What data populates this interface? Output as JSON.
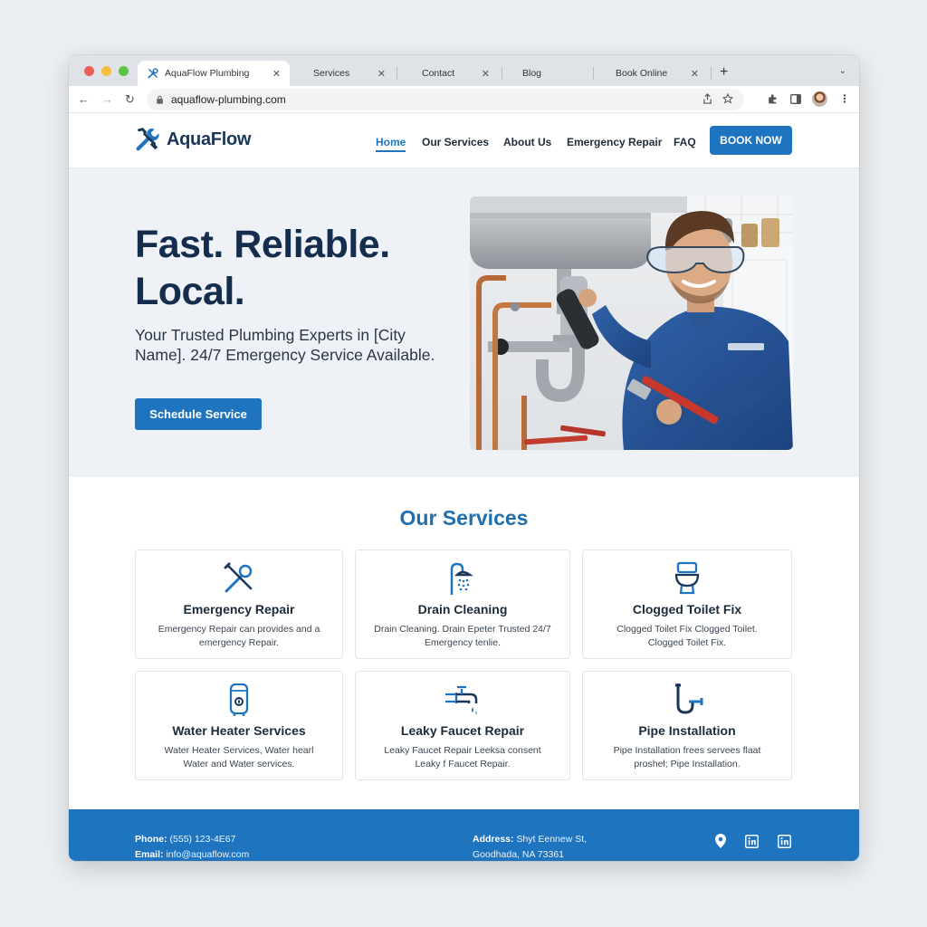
{
  "browser": {
    "tabs": [
      {
        "title": "AquaFlow Plumbing",
        "active": true
      },
      {
        "title": "Services"
      },
      {
        "title": "Contact"
      },
      {
        "title": "Blog"
      },
      {
        "title": "Book Online"
      }
    ],
    "close_glyph": "✕",
    "new_tab_glyph": "+",
    "url": "aquaflow-plumbing.com"
  },
  "header": {
    "logo_text": "AquaFlow",
    "menu": [
      "Home",
      "Our Services",
      "About Us",
      "Emergency Repair",
      "FAQ"
    ],
    "active_menu": "Home",
    "book_label": "BOOK NOW"
  },
  "hero": {
    "title": "Fast. Reliable. Local.",
    "subtitle": "Your Trusted Plumbing Experts in [City Name]. 24/7 Emergency Service Available.",
    "cta": "Schedule Service"
  },
  "services": {
    "title": "Our Services",
    "items": [
      {
        "title": "Emergency Repair",
        "desc": "Emergency Repair can provides and a emergency Repair.",
        "icon": "wrench-icon"
      },
      {
        "title": "Drain Cleaning",
        "desc": "Drain Cleaning. Drain Epeter Trusted 24/7 Emergency tenlie.",
        "icon": "shower-icon"
      },
      {
        "title": "Clogged Toilet Fix",
        "desc": "Clogged Toilet Fix Clogged Toilet. Clogged Toilet Fix.",
        "icon": "toilet-icon"
      },
      {
        "title": "Water Heater Services",
        "desc": "Water Heater Services, Water hearl Water and Water services.",
        "icon": "water-heater-icon"
      },
      {
        "title": "Leaky Faucet Repair",
        "desc": "Leaky Faucet Repair Leeksa consent Leaky f Faucet Repair.",
        "icon": "faucet-icon"
      },
      {
        "title": "Pipe Installation",
        "desc": "Pipe Installation frees servees flaat proshel; Pipe Installation.",
        "icon": "pipe-icon"
      }
    ]
  },
  "footer": {
    "phone_label": "Phone:",
    "phone": "(555) 123-4E67",
    "email_label": "Email:",
    "email": "info@aquaflow.com",
    "address_label": "Address:",
    "address_line1": "Shyt Eennew St,",
    "address_line2": "Goodhada, NA 73361"
  },
  "colors": {
    "accent": "#1f74c0",
    "title": "#152d4c",
    "hero_bg": "#eef2f7",
    "footer_bg": "#1f74c0"
  }
}
